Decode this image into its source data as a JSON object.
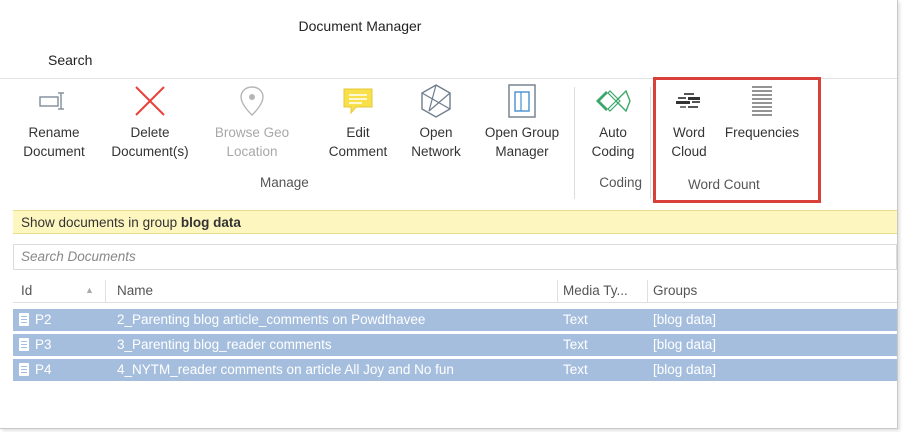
{
  "window": {
    "title": "Document Manager"
  },
  "tabs": {
    "search": "Search"
  },
  "ribbon": {
    "rename": [
      "Rename",
      "Document"
    ],
    "delete": [
      "Delete",
      "Document(s)"
    ],
    "browse_geo": [
      "Browse Geo",
      "Location"
    ],
    "edit_comment": [
      "Edit",
      "Comment"
    ],
    "open_network": [
      "Open",
      "Network"
    ],
    "open_group_manager": [
      "Open Group",
      "Manager"
    ],
    "auto_coding": [
      "Auto",
      "Coding"
    ],
    "word_cloud": [
      "Word",
      "Cloud"
    ],
    "frequencies": [
      "Frequencies"
    ],
    "groups": {
      "manage": "Manage",
      "coding": "Coding",
      "word_count": "Word Count"
    }
  },
  "filter": {
    "prefix": "Show documents in group",
    "group": "blog data"
  },
  "search": {
    "placeholder": "Search Documents"
  },
  "table": {
    "headers": {
      "id": "Id",
      "name": "Name",
      "media": "Media Ty...",
      "groups": "Groups"
    },
    "rows": [
      {
        "id": "P2",
        "name": "2_Parenting blog article_comments on Powdthavee",
        "media": "Text",
        "groups": "[blog data]"
      },
      {
        "id": "P3",
        "name": "3_Parenting blog_reader comments",
        "media": "Text",
        "groups": "[blog data]"
      },
      {
        "id": "P4",
        "name": "4_NYTM_reader comments on article All Joy and No fun",
        "media": "Text",
        "groups": "[blog data]"
      }
    ]
  },
  "colors": {
    "highlight_border": "#d9403a",
    "filter_bg": "#fef6bf",
    "selected_row": "#a5bedd",
    "delete_red": "#e8423b",
    "comment_yellow": "#f7e04a",
    "coding_green": "#3ba86a"
  }
}
